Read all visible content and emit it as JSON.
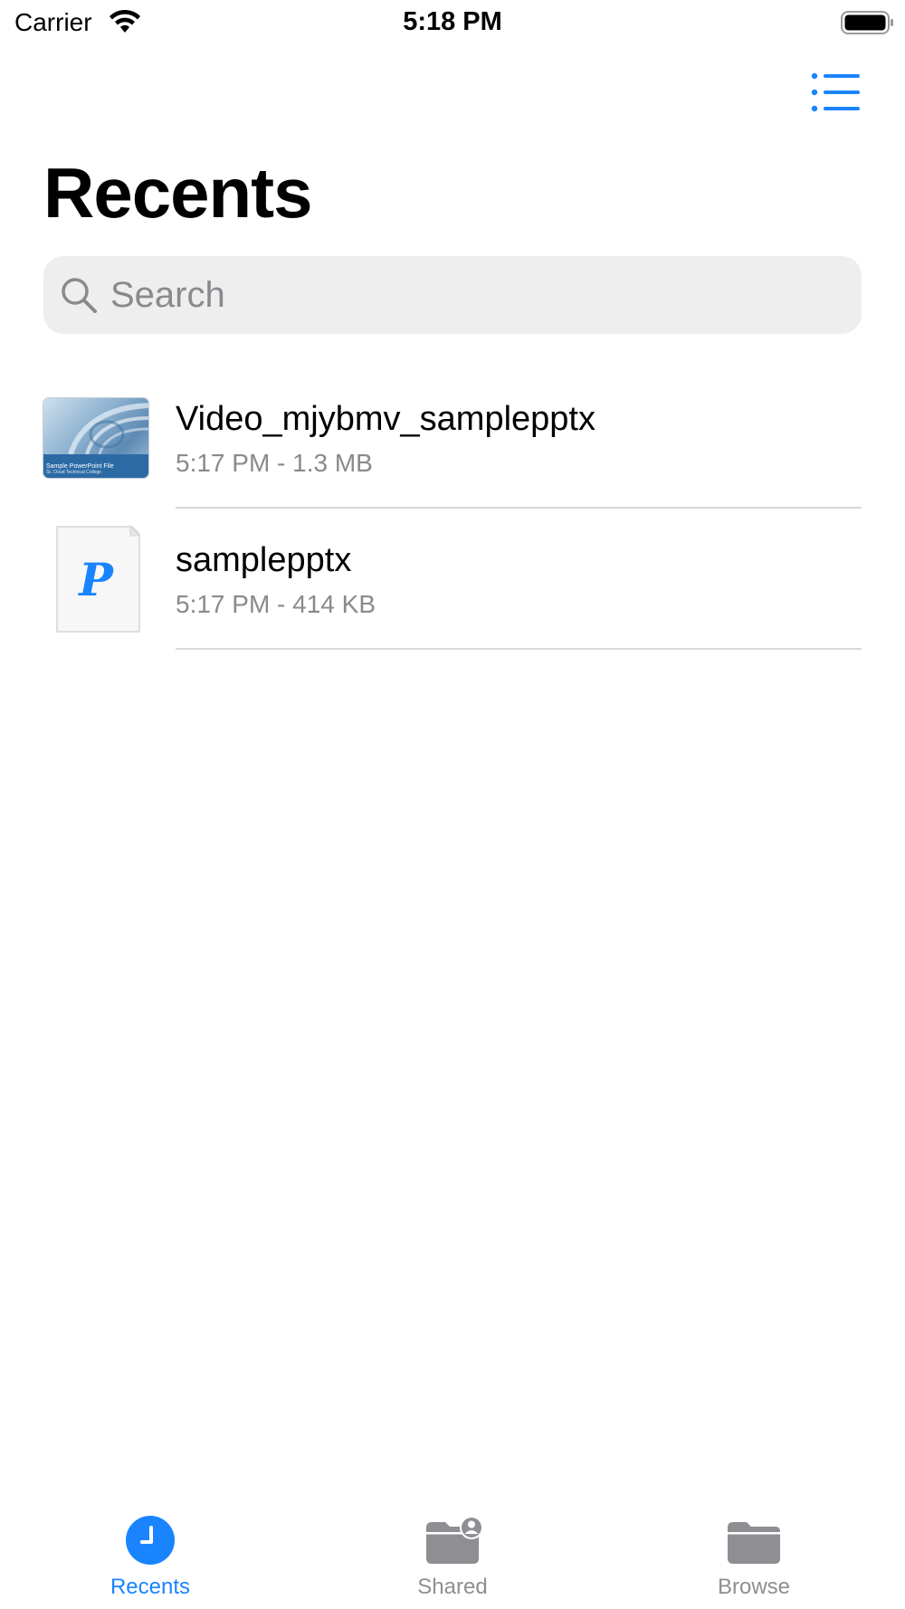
{
  "status_bar": {
    "carrier": "Carrier",
    "time": "5:18 PM"
  },
  "page": {
    "title": "Recents"
  },
  "search": {
    "placeholder": "Search",
    "value": ""
  },
  "files": [
    {
      "name": "Video_mjybmv_samplepptx",
      "meta": "5:17 PM - 1.3 MB",
      "thumbnail": "presentation-thumbnail",
      "thumb_title": "Sample PowerPoint File",
      "thumb_subtitle": "St. Cloud Technical College"
    },
    {
      "name": "samplepptx",
      "meta": "5:17 PM - 414 KB",
      "thumbnail": "pptx-document-icon",
      "thumb_letter": "P"
    }
  ],
  "tabs": [
    {
      "label": "Recents",
      "icon": "clock-icon",
      "active": true
    },
    {
      "label": "Shared",
      "icon": "shared-folder-icon",
      "active": false
    },
    {
      "label": "Browse",
      "icon": "folder-icon",
      "active": false
    }
  ],
  "colors": {
    "accent": "#1a84ff",
    "inactive": "#8e8e93",
    "secondary_text": "#8a8a8e",
    "search_bg": "#eeeeef"
  }
}
